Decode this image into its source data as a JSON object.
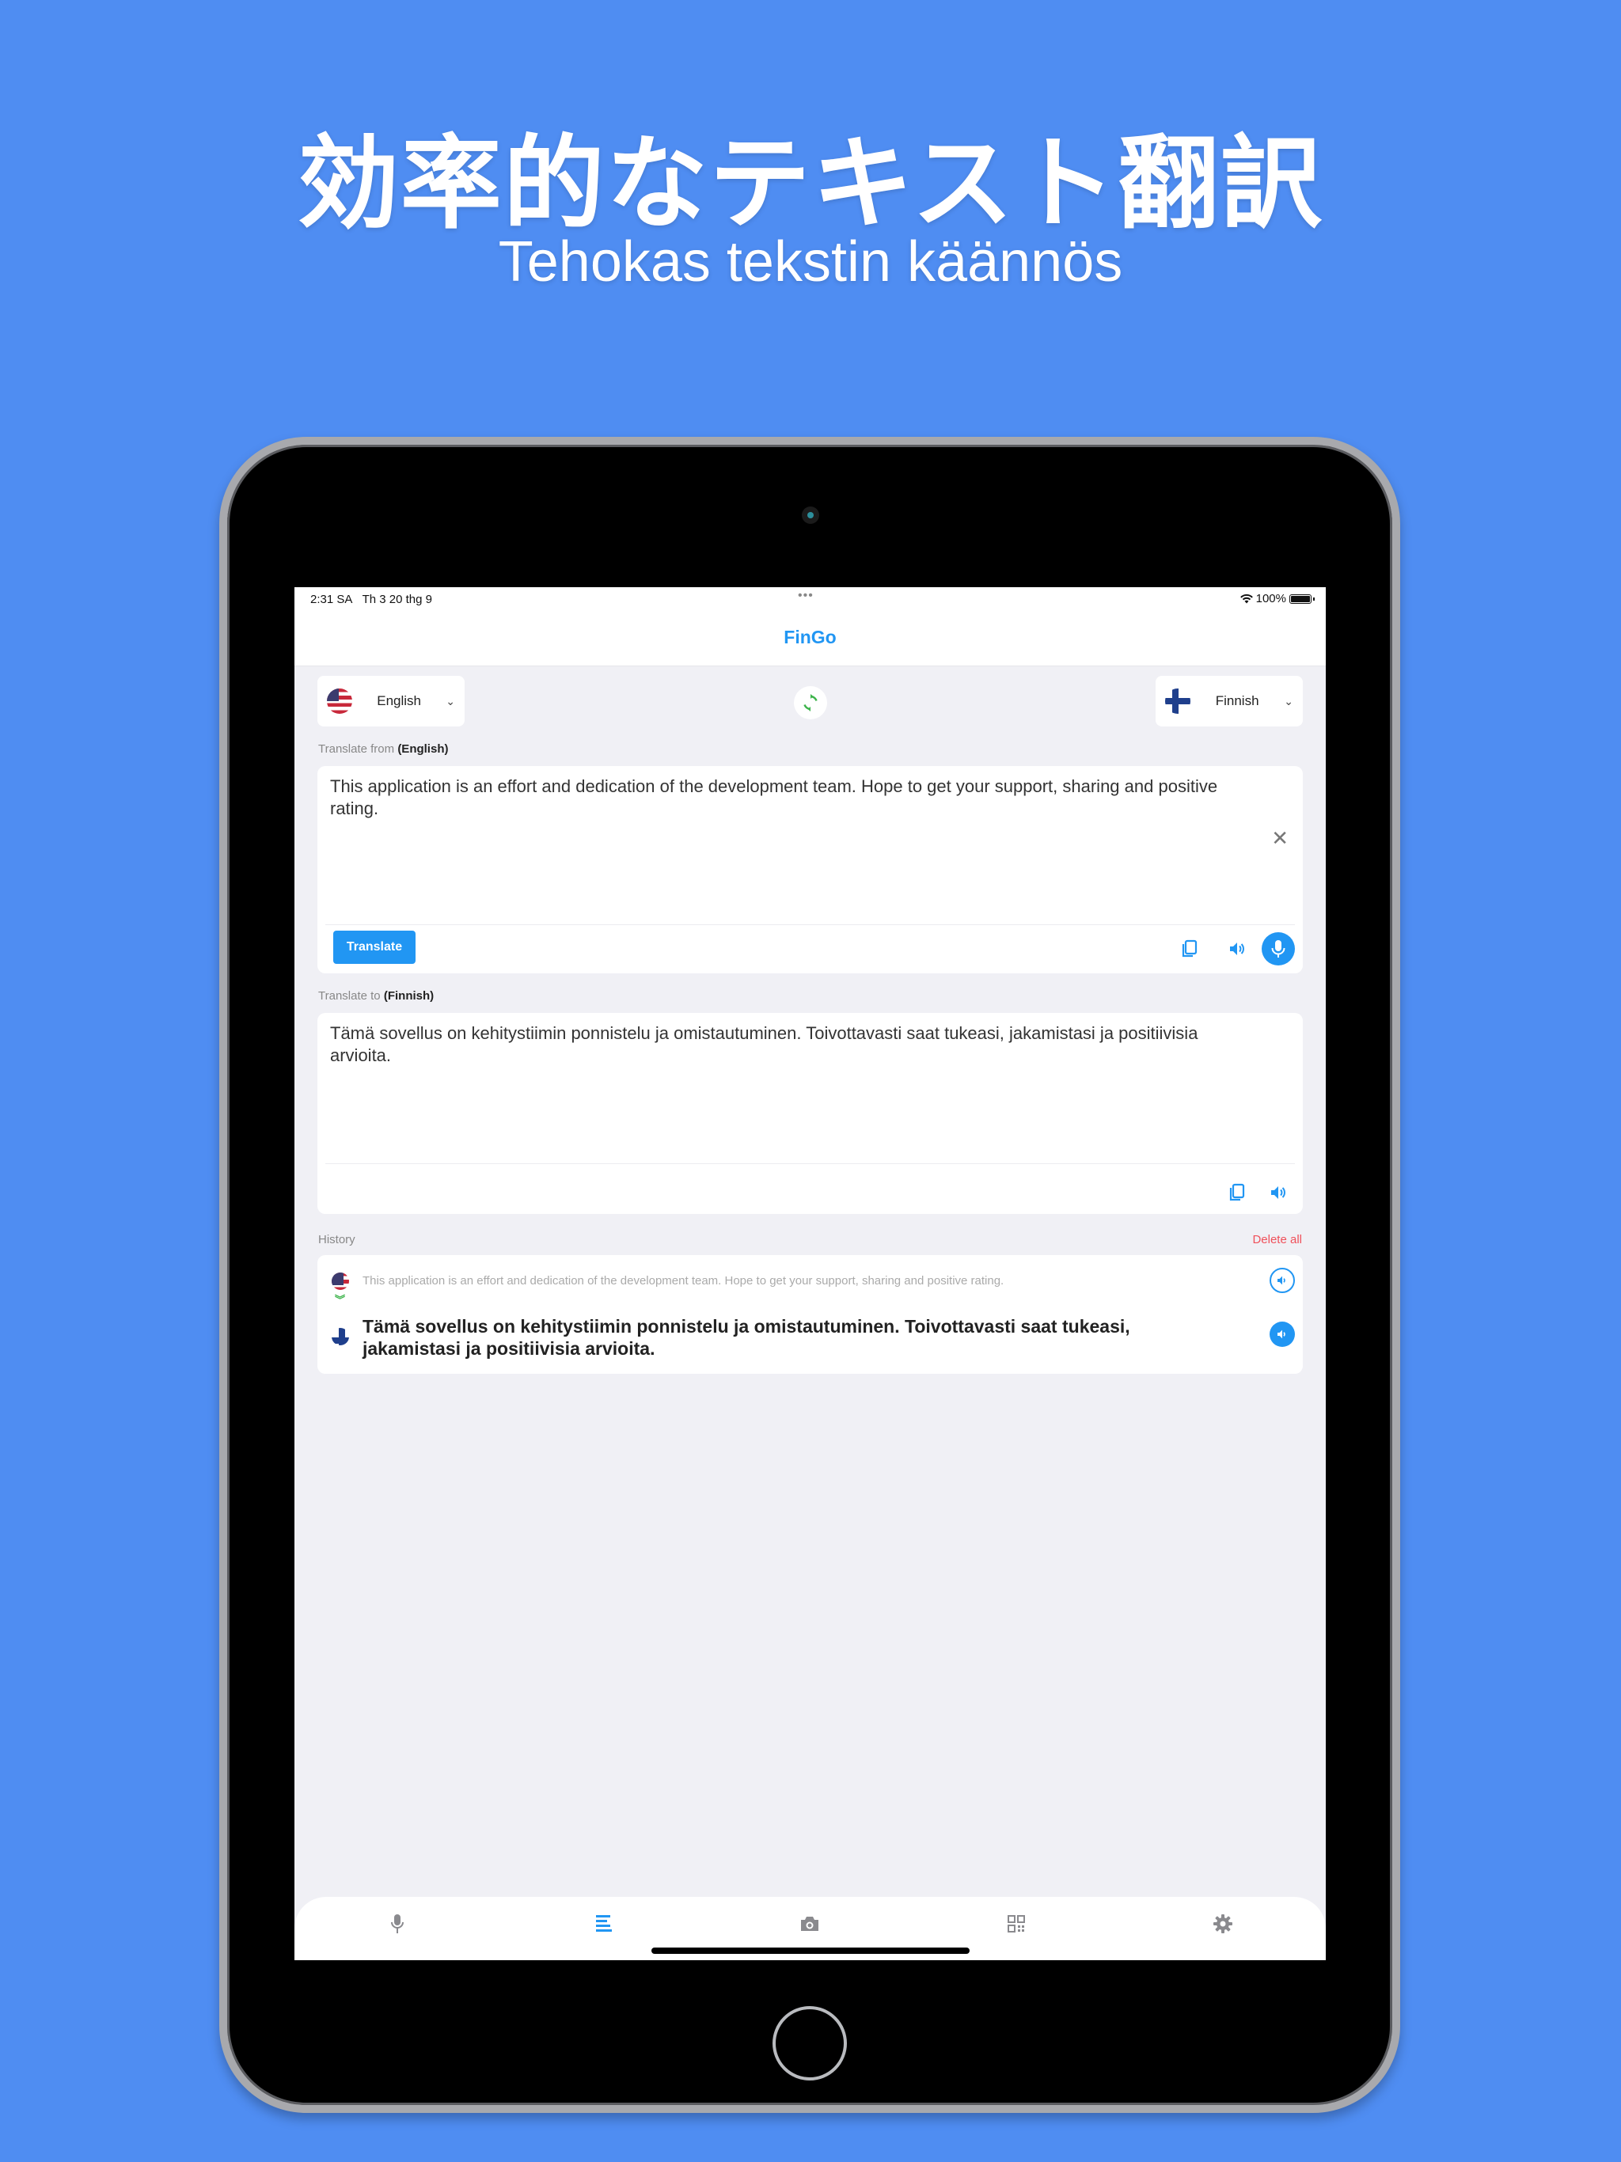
{
  "promo": {
    "title_ja": "効率的なテキスト翻訳",
    "subtitle_fi": "Tehokas tekstin käännös",
    "background_color": "#4f8df2"
  },
  "status_bar": {
    "time": "2:31 SA",
    "date": "Th 3 20 thg 9",
    "dots": "•••",
    "battery": "100%"
  },
  "app": {
    "title": "FinGo",
    "accent_color": "#2196f3"
  },
  "languages": {
    "source": {
      "name": "English",
      "flag": "us-flag"
    },
    "target": {
      "name": "Finnish",
      "flag": "finland-flag"
    },
    "swap_icon": "refresh-icon"
  },
  "source_section": {
    "label_prefix": "Translate from ",
    "label_lang": "(English)",
    "text": "This application is an effort and dedication of the development team. Hope to get your support, sharing and positive rating.",
    "translate_button": "Translate"
  },
  "target_section": {
    "label_prefix": "Translate to ",
    "label_lang": "(Finnish)",
    "text": "Tämä sovellus on kehitystiimin ponnistelu ja omistautuminen. Toivottavasti saat tukeasi, jakamistasi ja positiivisia arvioita."
  },
  "history": {
    "label": "History",
    "delete_all": "Delete all",
    "delete_color": "#f0505a",
    "items": [
      {
        "source": "This application is an effort and dedication of the development team. Hope to get your support, sharing and positive rating.",
        "target": "Tämä sovellus on kehitystiimin ponnistelu ja omistautuminen. Toivottavasti saat tukeasi, jakamistasi ja positiivisia arvioita."
      }
    ]
  },
  "tabbar": {
    "tabs": [
      {
        "name": "voice",
        "icon": "microphone-icon",
        "active": false
      },
      {
        "name": "text",
        "icon": "text-lines-icon",
        "active": true
      },
      {
        "name": "camera",
        "icon": "camera-icon",
        "active": false
      },
      {
        "name": "qr",
        "icon": "qr-code-icon",
        "active": false
      },
      {
        "name": "settings",
        "icon": "gear-icon",
        "active": false
      }
    ]
  }
}
